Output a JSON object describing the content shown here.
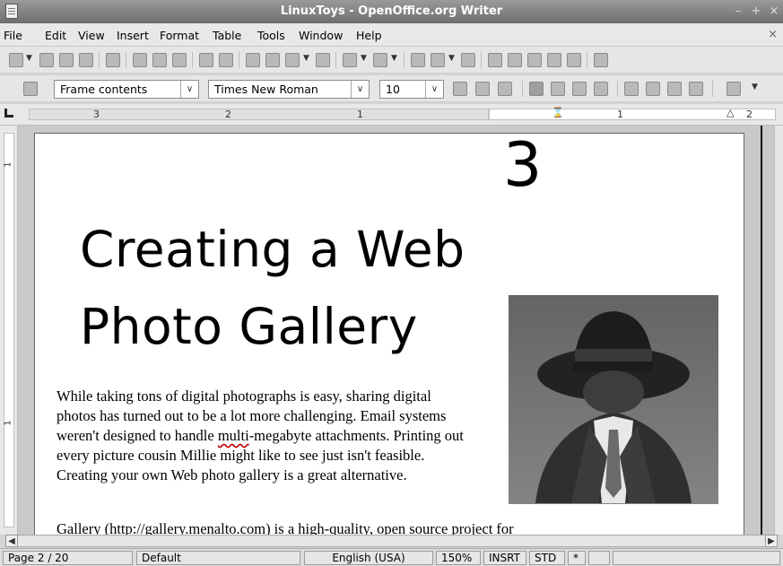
{
  "window": {
    "title": "LinuxToys - OpenOffice.org Writer"
  },
  "menu": [
    "File",
    "Edit",
    "View",
    "Insert",
    "Format",
    "Table",
    "Tools",
    "Window",
    "Help"
  ],
  "formatting": {
    "paragraph_style": "Frame contents",
    "font_name": "Times New Roman",
    "font_size": "10"
  },
  "ruler": {
    "labels": [
      "3",
      "2",
      "1",
      "1",
      "2"
    ]
  },
  "vruler": {
    "labels": [
      "1",
      "1"
    ]
  },
  "document": {
    "chapter_number": "3",
    "heading_line1": "Creating a Web",
    "heading_line2": "Photo Gallery",
    "para1_before": "While taking tons of digital photographs is easy, sharing digital photos has turned out to be a lot more challenging. Email systems weren't designed to handle ",
    "para1_misspelled": "multi",
    "para1_after": "-megabyte attachments. Printing out every picture cousin Millie might like to see just isn't feasible. Creating your own Web photo gallery is a great alternative.",
    "para2": "Gallery (http://gallery.menalto.com) is a high-quality, open source project for"
  },
  "status": {
    "page": "Page 2 / 20",
    "style": "Default",
    "language": "English (USA)",
    "zoom": "150%",
    "insert_mode": "INSRT",
    "selection_mode": "STD",
    "modified": "*"
  }
}
